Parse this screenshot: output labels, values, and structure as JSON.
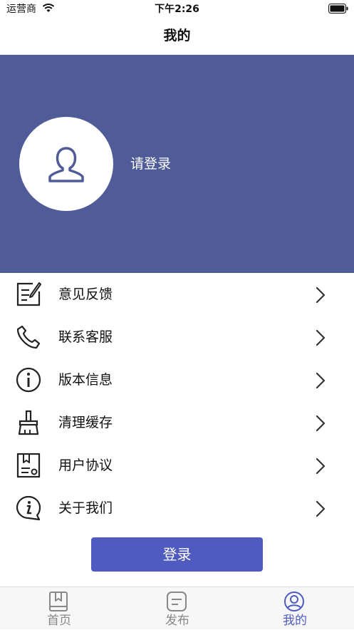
{
  "status_bar": {
    "carrier": "运营商",
    "time": "下午2:26"
  },
  "nav": {
    "title": "我的"
  },
  "profile": {
    "login_prompt": "请登录"
  },
  "menu": {
    "items": [
      {
        "label": "意见反馈",
        "icon": "feedback-icon"
      },
      {
        "label": "联系客服",
        "icon": "phone-icon"
      },
      {
        "label": "版本信息",
        "icon": "info-icon"
      },
      {
        "label": "清理缓存",
        "icon": "brush-icon"
      },
      {
        "label": "用户协议",
        "icon": "agreement-icon"
      },
      {
        "label": "关于我们",
        "icon": "about-icon"
      }
    ]
  },
  "login_button": {
    "label": "登录"
  },
  "tab_bar": {
    "tabs": [
      {
        "label": "首页",
        "icon": "book-icon",
        "active": false
      },
      {
        "label": "发布",
        "icon": "publish-icon",
        "active": false
      },
      {
        "label": "我的",
        "icon": "user-circle-icon",
        "active": true
      }
    ]
  },
  "colors": {
    "header_bg": "#4f5c97",
    "primary": "#4f5bbf",
    "tab_active": "#4f5bbf",
    "tab_inactive": "#888888"
  }
}
